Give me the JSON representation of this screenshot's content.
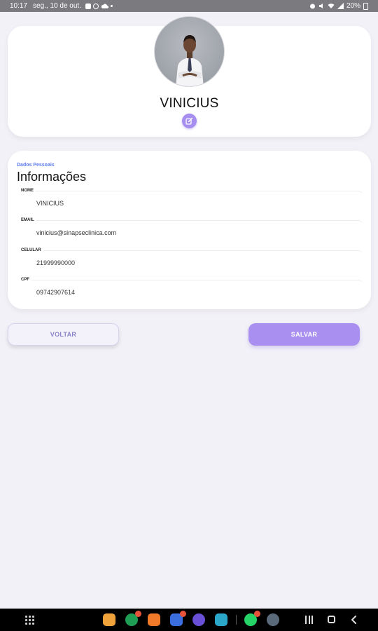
{
  "status_bar": {
    "time": "10:17",
    "date": "seg., 10 de out.",
    "battery": "20%"
  },
  "profile": {
    "name": "VINICIUS",
    "avatar_icon": "profile-photo",
    "edit_icon": "edit-icon"
  },
  "info": {
    "kicker": "Dados Pessoais",
    "title": "Informações",
    "fields": [
      {
        "label": "NOME",
        "value": "VINICIUS"
      },
      {
        "label": "EMAIL",
        "value": "vinicius@sinapseclinica.com"
      },
      {
        "label": "CELULAR",
        "value": "21999990000"
      },
      {
        "label": "CPF",
        "value": "09742907614"
      }
    ]
  },
  "actions": {
    "back_label": "VOLTAR",
    "save_label": "SALVAR"
  },
  "colors": {
    "accent": "#a88ff0",
    "background": "#f2f1f7",
    "kicker": "#5c7cf0"
  }
}
